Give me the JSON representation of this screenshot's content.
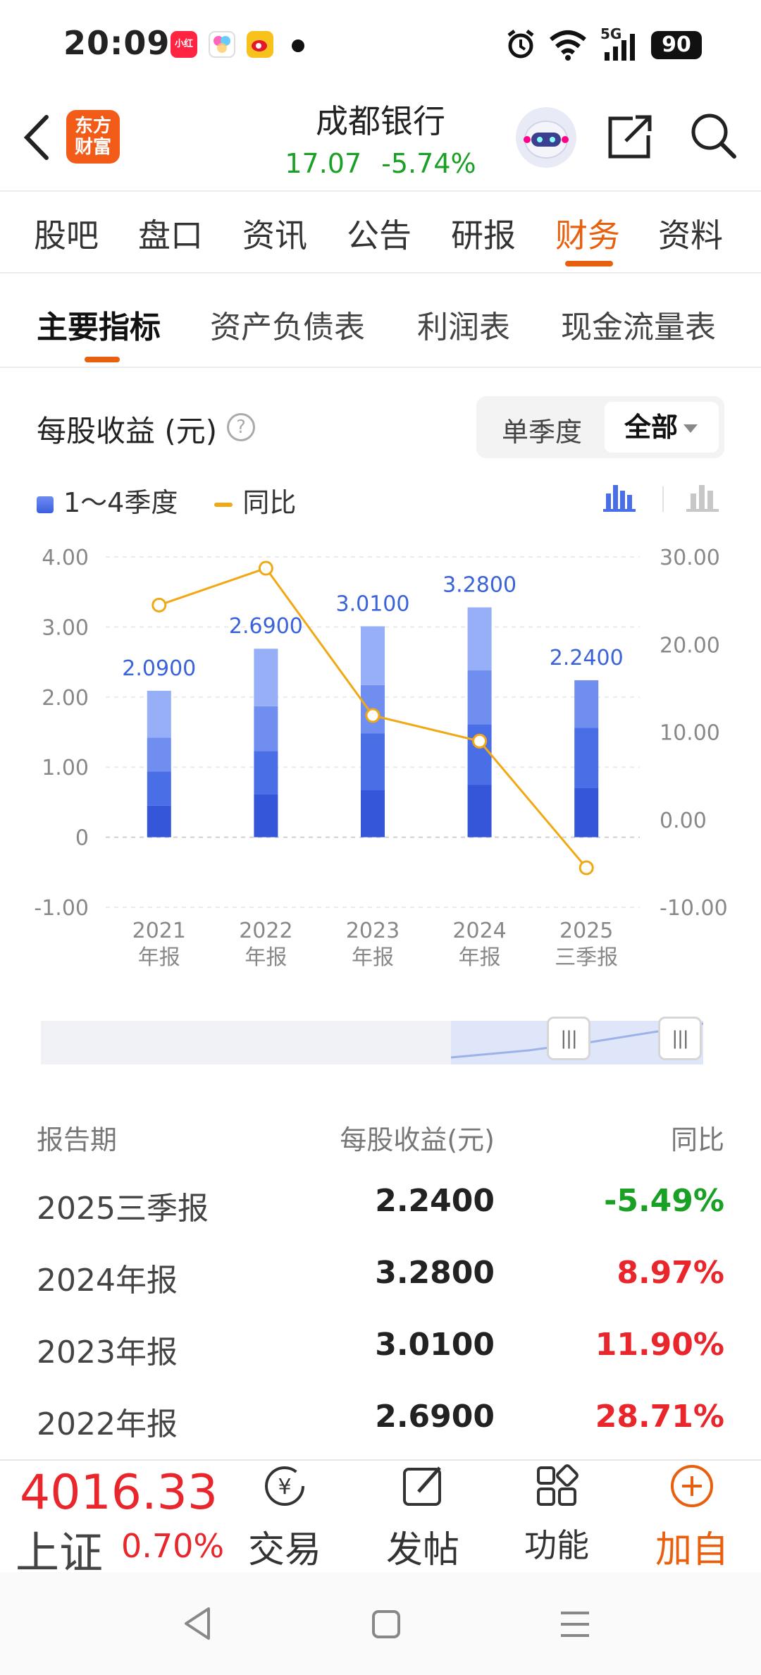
{
  "status_bar": {
    "time": "20:09",
    "apps": [
      "小红书",
      "",
      ""
    ],
    "network": "5G",
    "battery": "90"
  },
  "header": {
    "logo_line1": "东方",
    "logo_line2": "财富",
    "stock_name": "成都银行",
    "price": "17.07",
    "change_pct": "-5.74%"
  },
  "tabs": [
    "股吧",
    "盘口",
    "资讯",
    "公告",
    "研报",
    "财务",
    "资料"
  ],
  "active_tab": "财务",
  "sub_tabs": [
    "主要指标",
    "资产负债表",
    "利润表",
    "现金流量表"
  ],
  "active_sub_tab": "主要指标",
  "chart_header": {
    "title": "每股收益 (元)",
    "help": "?",
    "seg_single": "单季度",
    "seg_all": "全部"
  },
  "legend": {
    "bar": "1～4季度",
    "line": "同比"
  },
  "chart_data": {
    "type": "bar",
    "categories": [
      "2021\n年报",
      "2022\n年报",
      "2023\n年报",
      "2024\n年报",
      "2025\n三季报"
    ],
    "cat_line1": [
      "2021",
      "2022",
      "2023",
      "2024",
      "2025"
    ],
    "cat_line2": [
      "年报",
      "年报",
      "年报",
      "年报",
      "三季报"
    ],
    "values": [
      2.09,
      2.69,
      3.01,
      3.28,
      2.24
    ],
    "value_labels": [
      "2.0900",
      "2.6900",
      "3.0100",
      "3.2800",
      "2.2400"
    ],
    "quarter_cumulative": [
      [
        0.45,
        0.94,
        1.42,
        2.09
      ],
      [
        0.61,
        1.23,
        1.87,
        2.69
      ],
      [
        0.67,
        1.48,
        2.17,
        3.01
      ],
      [
        0.75,
        1.61,
        2.38,
        3.28
      ],
      [
        0.7,
        1.56,
        2.24
      ]
    ],
    "yoy_series": {
      "name": "同比",
      "values": [
        24.5,
        28.71,
        11.9,
        8.97,
        -5.49
      ]
    },
    "y_left_ticks": [
      "4.00",
      "3.00",
      "2.00",
      "1.00",
      "0",
      "-1.00"
    ],
    "y_right_ticks": [
      "30.00",
      "20.00",
      "10.00",
      "0.00",
      "-10.00"
    ],
    "ylim_left": [
      -1,
      4
    ],
    "ylim_right": [
      -10,
      30
    ],
    "bar_colors": [
      "#3556d8",
      "#4a6ee6",
      "#6f8ef0",
      "#96aff6"
    ],
    "line_color": "#f0a914",
    "grid": true
  },
  "table": {
    "headers": [
      "报告期",
      "每股收益(元)",
      "同比"
    ],
    "rows": [
      {
        "period": "2025三季报",
        "eps": "2.2400",
        "yoy": "-5.49%"
      },
      {
        "period": "2024年报",
        "eps": "3.2800",
        "yoy": "8.97%"
      },
      {
        "period": "2023年报",
        "eps": "3.0100",
        "yoy": "11.90%"
      },
      {
        "period": "2022年报",
        "eps": "2.6900",
        "yoy": "28.71%"
      }
    ]
  },
  "bottom_bar": {
    "index_value": "4016.33",
    "index_name": "上证",
    "index_pct": "0.70%",
    "trade": "交易",
    "post": "发帖",
    "func": "功能",
    "add": "加自"
  },
  "colors": {
    "accent": "#e8600d",
    "up": "#e8262b",
    "down": "#1aa125"
  }
}
